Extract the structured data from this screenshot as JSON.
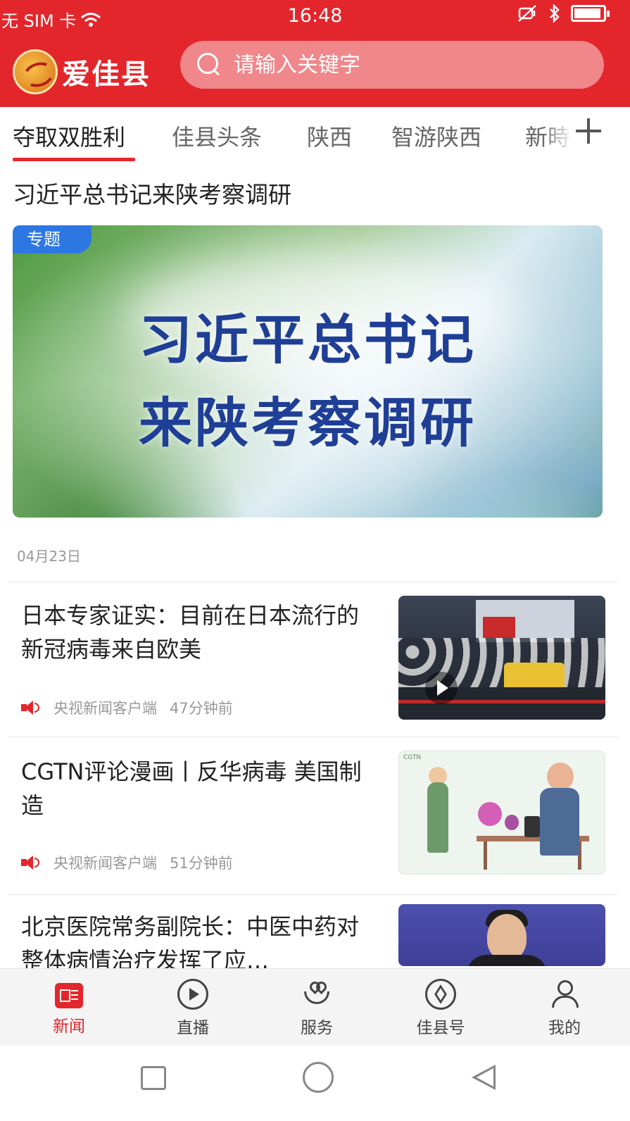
{
  "status_bar": {
    "carrier": "无 SIM 卡",
    "time": "16:48",
    "icons": [
      "wifi-icon",
      "mute-icon",
      "bluetooth-icon",
      "battery-icon"
    ],
    "battery_level": 0.92
  },
  "header": {
    "app_name": "爱佳县",
    "search_placeholder": "请输入关键字",
    "brand_color": "#e3262c"
  },
  "tabs": {
    "items": [
      {
        "label": "夺取双胜利"
      },
      {
        "label": "佳县头条"
      },
      {
        "label": "陕西"
      },
      {
        "label": "智游陕西"
      },
      {
        "label": "新時"
      }
    ],
    "active_index": 0,
    "add_icon": "plus-icon"
  },
  "feature": {
    "title": "习近平总书记来陕考察调研",
    "badge": "专题",
    "overlay_line1": "习近平总书记",
    "overlay_line2": "来陕考察调研",
    "date": "04月23日"
  },
  "news": [
    {
      "headline": "日本专家证实：目前在日本流行的新冠病毒来自欧美",
      "source": "央视新闻客户端",
      "time_ago": "47分钟前",
      "has_video": true
    },
    {
      "headline": "CGTN评论漫画丨反华病毒 美国制造",
      "source": "央视新闻客户端",
      "time_ago": "51分钟前",
      "thumb_tag": "CGTN"
    },
    {
      "headline": "北京医院常务副院长：中医中药对整体病情治疗发挥了应…"
    }
  ],
  "bottom_nav": {
    "items": [
      {
        "label": "新闻",
        "icon": "news-icon"
      },
      {
        "label": "直播",
        "icon": "play-circle-icon"
      },
      {
        "label": "服务",
        "icon": "heart-hands-icon"
      },
      {
        "label": "佳县号",
        "icon": "compass-icon"
      },
      {
        "label": "我的",
        "icon": "person-icon"
      }
    ],
    "active_index": 0
  }
}
